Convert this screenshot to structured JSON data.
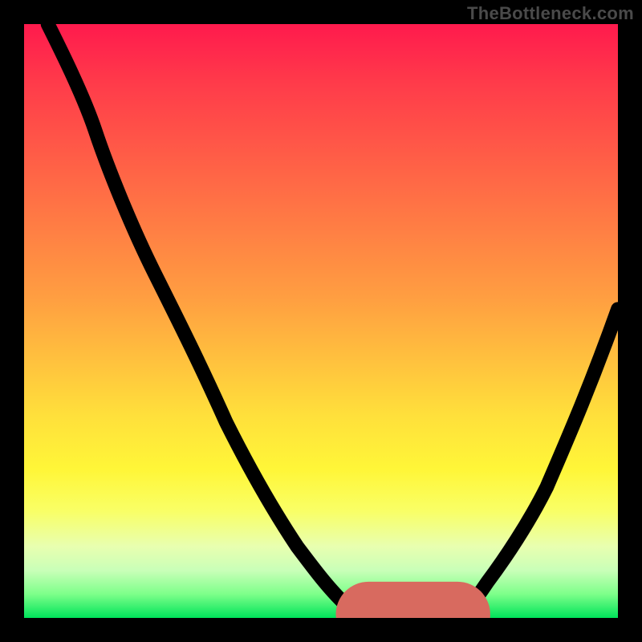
{
  "watermark": "TheBottleneck.com",
  "colors": {
    "background": "#000000",
    "curve": "#000000",
    "highlight": "#d86a5f",
    "gradient_top": "#ff1a4d",
    "gradient_bottom": "#00e35a"
  },
  "chart_data": {
    "type": "line",
    "title": "",
    "xlabel": "",
    "ylabel": "",
    "xlim": [
      0,
      100
    ],
    "ylim": [
      0,
      100
    ],
    "series": [
      {
        "name": "left-curve",
        "x": [
          4,
          8,
          12,
          16,
          22,
          28,
          34,
          40,
          46,
          52,
          56,
          58
        ],
        "values": [
          100,
          92,
          82,
          72,
          58,
          45,
          33,
          22,
          12,
          4,
          1,
          0
        ]
      },
      {
        "name": "right-curve",
        "x": [
          73,
          76,
          80,
          85,
          90,
          95,
          100
        ],
        "values": [
          0,
          3,
          8,
          16,
          26,
          38,
          52
        ]
      }
    ],
    "highlight_segment": {
      "x": [
        58,
        73
      ],
      "values": [
        0,
        0
      ]
    },
    "highlight_dot": {
      "x": 58,
      "y": 0
    },
    "grid": false,
    "legend": false
  }
}
